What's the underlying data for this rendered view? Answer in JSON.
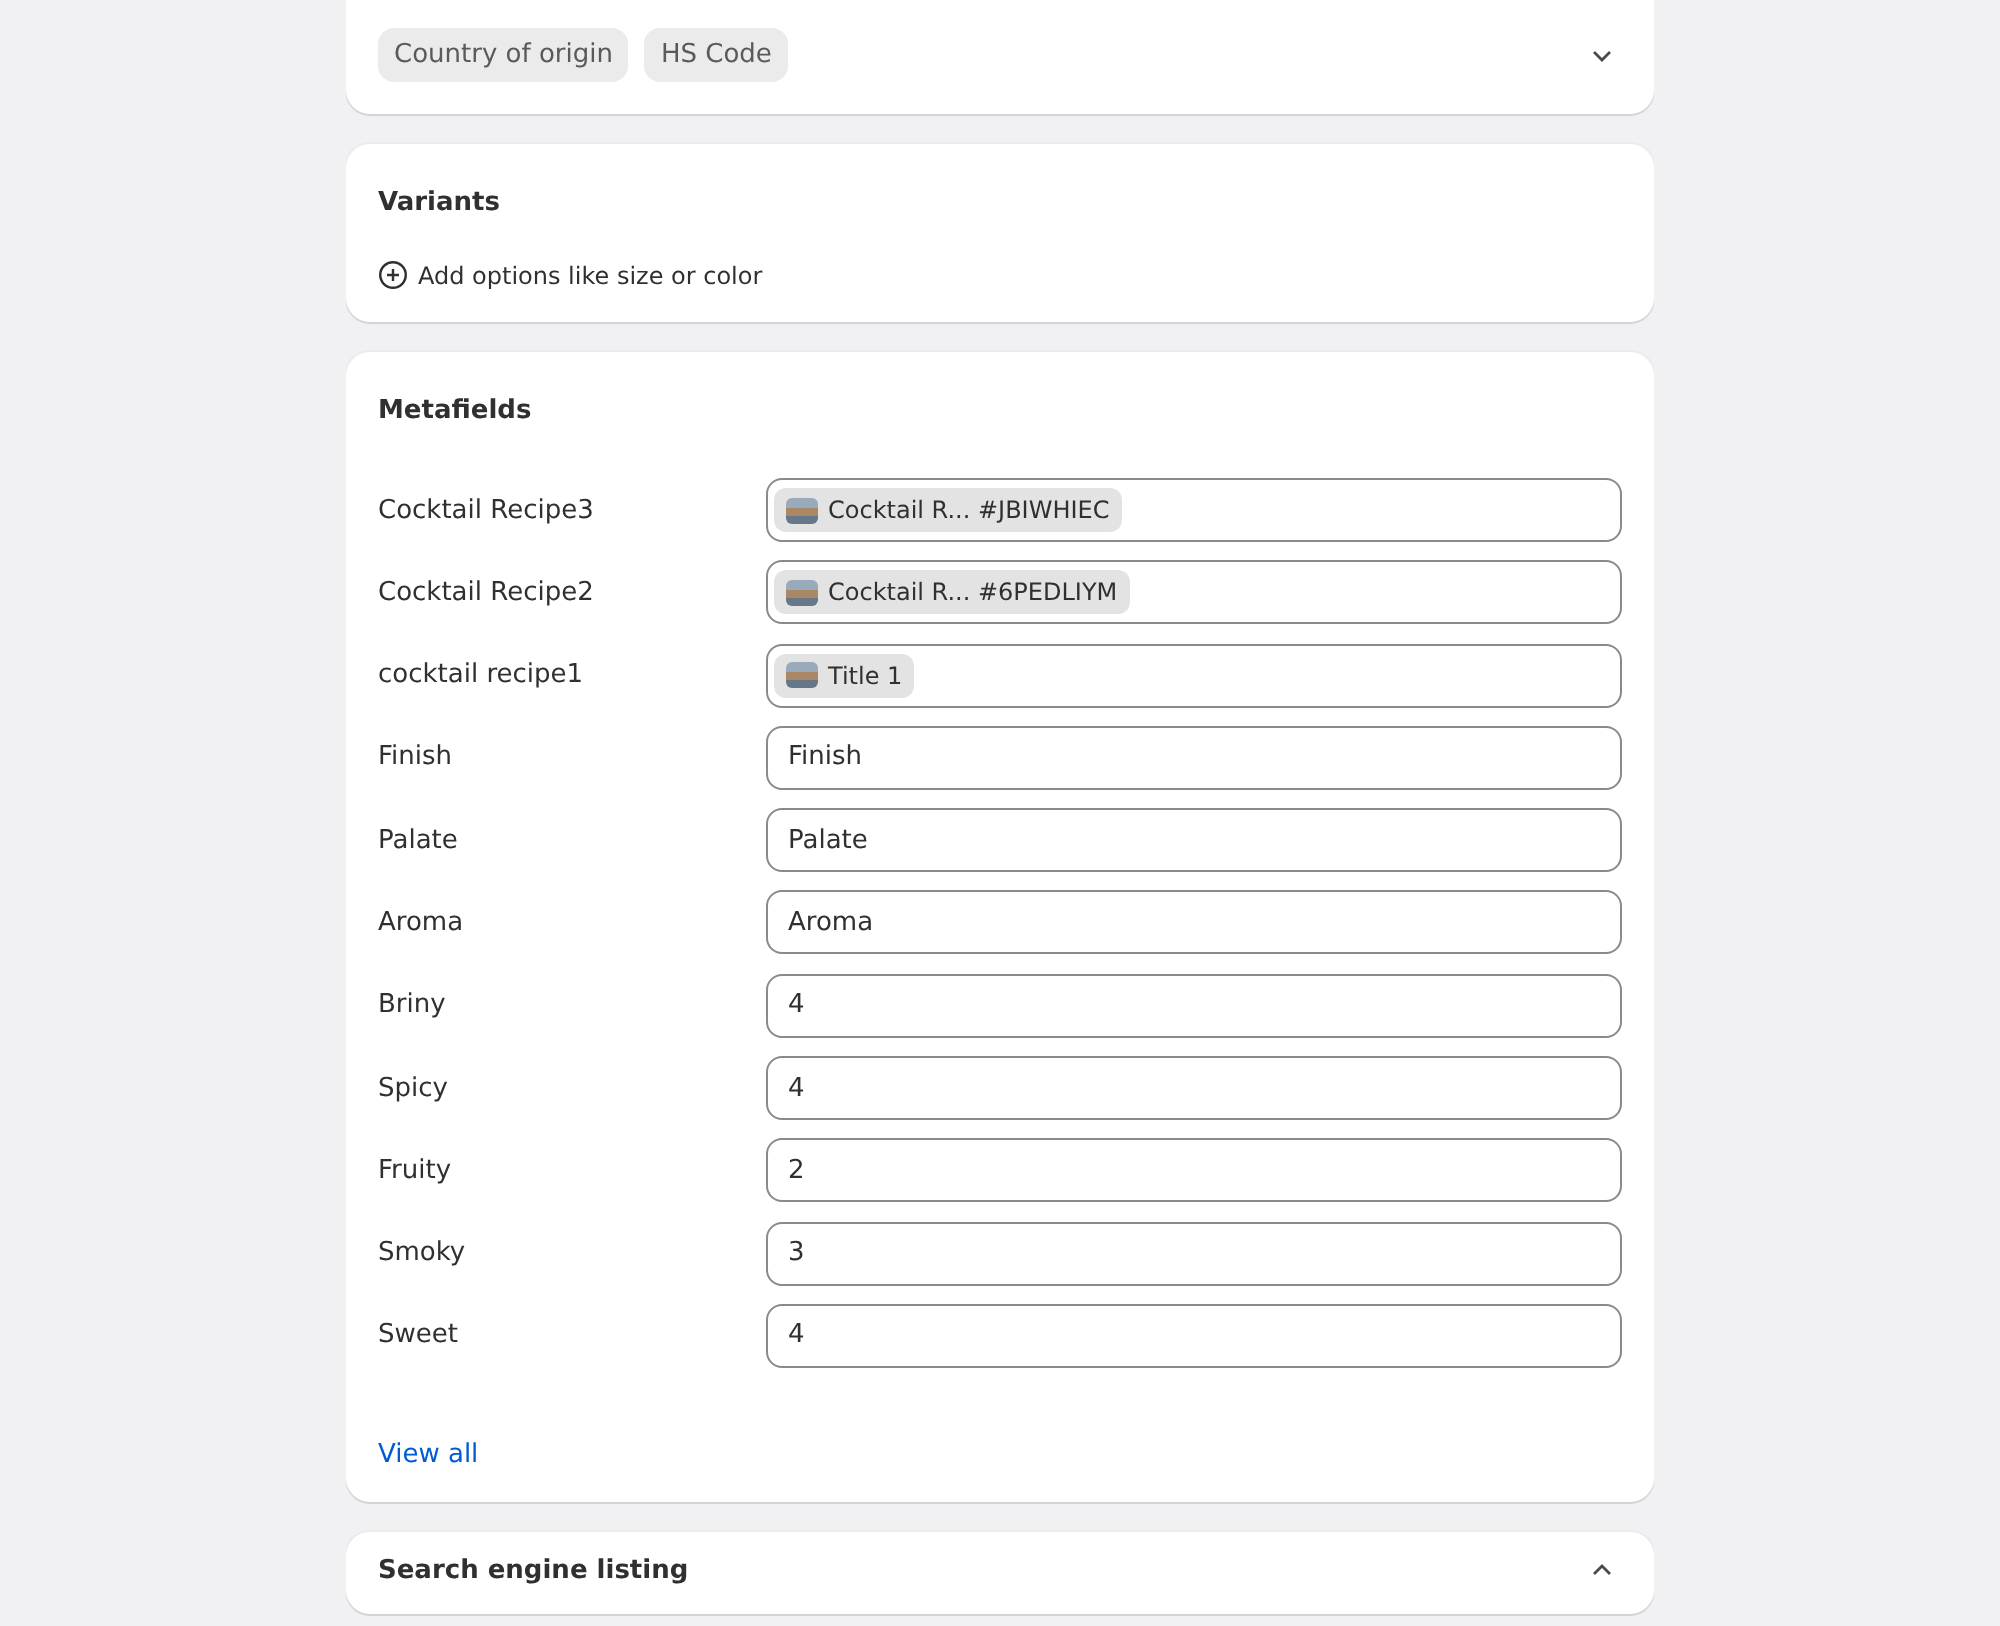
{
  "shipping_card": {
    "chips": [
      "Country of origin",
      "HS Code"
    ],
    "expanded": false
  },
  "variants": {
    "title": "Variants",
    "add_label": "Add options like size or color"
  },
  "metafields": {
    "title": "Metafields",
    "rows": [
      {
        "label": "Cocktail Recipe3",
        "kind": "reference",
        "value": "Cocktail R... #JBIWHIEC"
      },
      {
        "label": "Cocktail Recipe2",
        "kind": "reference",
        "value": "Cocktail R... #6PEDLIYM"
      },
      {
        "label": "cocktail recipe1",
        "kind": "reference",
        "value": "Title 1"
      },
      {
        "label": "Finish",
        "kind": "text",
        "value": "Finish"
      },
      {
        "label": "Palate",
        "kind": "text",
        "value": "Palate"
      },
      {
        "label": "Aroma",
        "kind": "text",
        "value": "Aroma"
      },
      {
        "label": "Briny",
        "kind": "text",
        "value": "4"
      },
      {
        "label": "Spicy",
        "kind": "text",
        "value": "4"
      },
      {
        "label": "Fruity",
        "kind": "text",
        "value": "2"
      },
      {
        "label": "Smoky",
        "kind": "text",
        "value": "3"
      },
      {
        "label": "Sweet",
        "kind": "text",
        "value": "4"
      }
    ],
    "view_all": "View all"
  },
  "seo": {
    "title": "Search engine listing",
    "expanded": true
  }
}
